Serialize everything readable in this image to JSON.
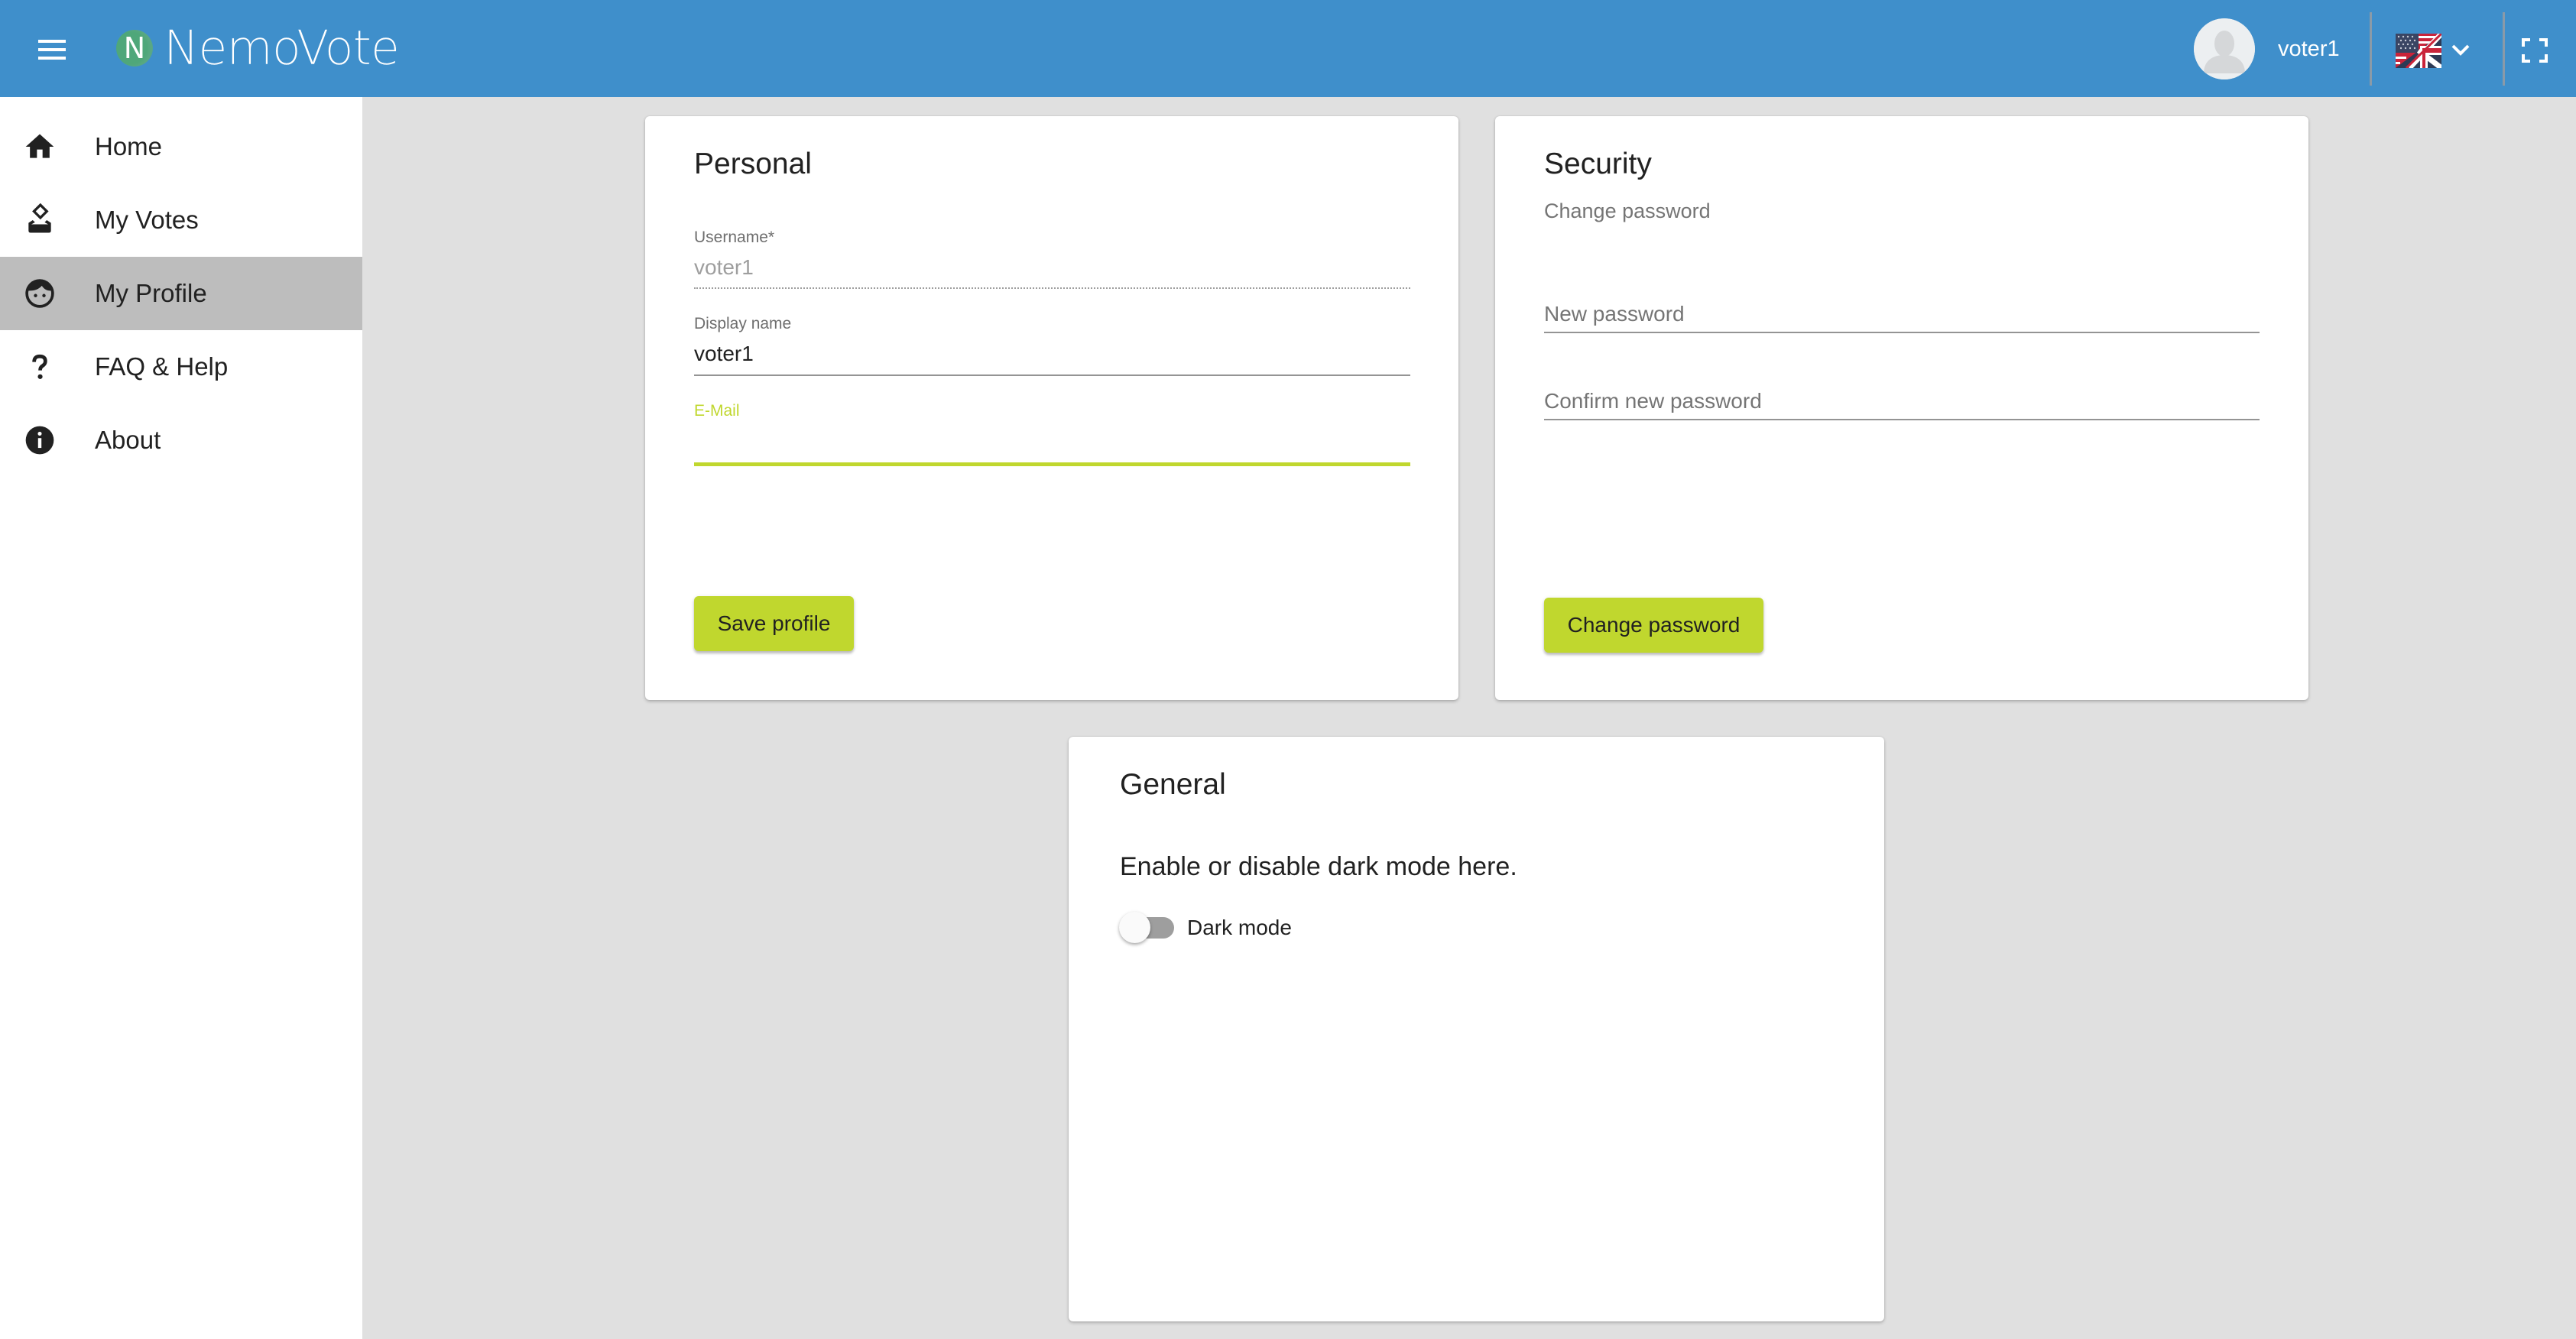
{
  "header": {
    "app_name": "NemoVote",
    "logo_letter": "N",
    "user_name": "voter1",
    "language": "English",
    "colors": {
      "bar": "#3f8fcb",
      "logo": "#4fa77a"
    }
  },
  "sidebar": {
    "items": [
      {
        "label": "Home",
        "icon": "home-icon",
        "active": false
      },
      {
        "label": "My Votes",
        "icon": "ballot-box-icon",
        "active": false
      },
      {
        "label": "My Profile",
        "icon": "face-icon",
        "active": true
      },
      {
        "label": "FAQ & Help",
        "icon": "question-mark-icon",
        "active": false
      },
      {
        "label": "About",
        "icon": "info-icon",
        "active": false
      }
    ]
  },
  "personal": {
    "title": "Personal",
    "username": {
      "label": "Username*",
      "value": "voter1",
      "disabled": true
    },
    "display_name": {
      "label": "Display name",
      "value": "voter1"
    },
    "email": {
      "label": "E-Mail",
      "value": "",
      "focused": true
    },
    "save_label": "Save profile"
  },
  "security": {
    "title": "Security",
    "subtitle": "Change password",
    "new_password": {
      "placeholder": "New password",
      "value": ""
    },
    "confirm_password": {
      "placeholder": "Confirm new password",
      "value": ""
    },
    "change_label": "Change password"
  },
  "general": {
    "title": "General",
    "description": "Enable or disable dark mode here.",
    "dark_mode": {
      "label": "Dark mode",
      "enabled": false
    }
  },
  "theme": {
    "accent": "#c0d72e",
    "background": "#e0e0e0",
    "sidebar_active": "#bdbdbd"
  }
}
